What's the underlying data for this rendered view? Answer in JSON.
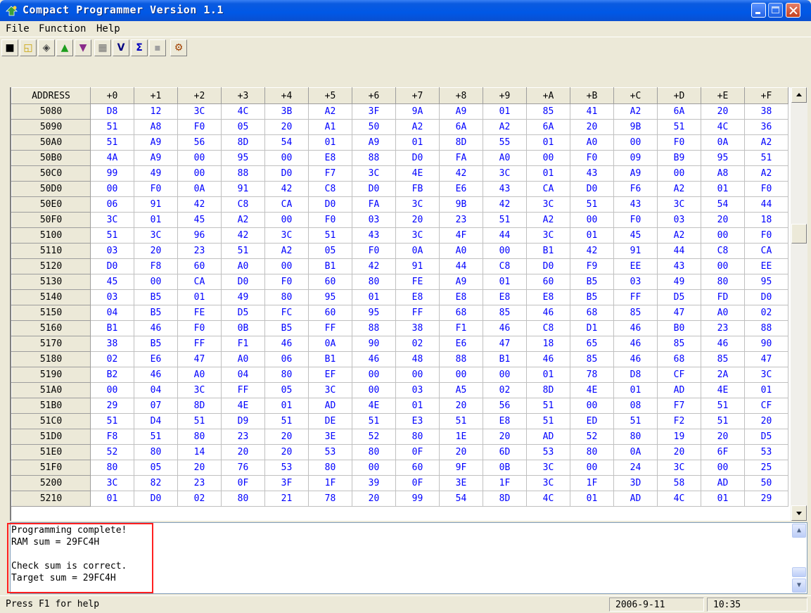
{
  "window": {
    "title": "Compact Programmer Version 1.1"
  },
  "menu": [
    {
      "label": "File",
      "name": "menu-file"
    },
    {
      "label": "Function",
      "name": "menu-function"
    },
    {
      "label": "Help",
      "name": "menu-help"
    }
  ],
  "toolbar": [
    {
      "name": "save-icon",
      "glyph": "■",
      "color": "#000000"
    },
    {
      "name": "open-folder-icon",
      "glyph": "◱",
      "color": "#c8a000"
    },
    {
      "name": "read-chip-icon",
      "glyph": "◈",
      "color": "#404040"
    },
    {
      "name": "upload-arrow-icon",
      "glyph": "▲",
      "color": "#1e9e1e"
    },
    {
      "name": "download-arrow-icon",
      "glyph": "▼",
      "color": "#8a2a8a"
    },
    {
      "name": "erase-icon",
      "glyph": "▦",
      "color": "#707070"
    },
    {
      "name": "verify-icon",
      "glyph": "V",
      "color": "#000080"
    },
    {
      "name": "checksum-icon",
      "glyph": "Σ",
      "color": "#0000c0"
    },
    {
      "name": "lock-icon",
      "glyph": "▪",
      "color": "#a0a0a0"
    },
    {
      "name": "config-icon",
      "glyph": "⚙",
      "color": "#a04000"
    }
  ],
  "grid": {
    "address_header": "ADDRESS",
    "col_headers": [
      "+0",
      "+1",
      "+2",
      "+3",
      "+4",
      "+5",
      "+6",
      "+7",
      "+8",
      "+9",
      "+A",
      "+B",
      "+C",
      "+D",
      "+E",
      "+F"
    ],
    "rows": [
      {
        "addr": "5080",
        "bytes": [
          "D8",
          "12",
          "3C",
          "4C",
          "3B",
          "A2",
          "3F",
          "9A",
          "A9",
          "01",
          "85",
          "41",
          "A2",
          "6A",
          "20",
          "38"
        ]
      },
      {
        "addr": "5090",
        "bytes": [
          "51",
          "A8",
          "F0",
          "05",
          "20",
          "A1",
          "50",
          "A2",
          "6A",
          "A2",
          "6A",
          "20",
          "9B",
          "51",
          "4C",
          "36"
        ]
      },
      {
        "addr": "50A0",
        "bytes": [
          "51",
          "A9",
          "56",
          "8D",
          "54",
          "01",
          "A9",
          "01",
          "8D",
          "55",
          "01",
          "A0",
          "00",
          "F0",
          "0A",
          "A2"
        ]
      },
      {
        "addr": "50B0",
        "bytes": [
          "4A",
          "A9",
          "00",
          "95",
          "00",
          "E8",
          "88",
          "D0",
          "FA",
          "A0",
          "00",
          "F0",
          "09",
          "B9",
          "95",
          "51"
        ]
      },
      {
        "addr": "50C0",
        "bytes": [
          "99",
          "49",
          "00",
          "88",
          "D0",
          "F7",
          "3C",
          "4E",
          "42",
          "3C",
          "01",
          "43",
          "A9",
          "00",
          "A8",
          "A2"
        ]
      },
      {
        "addr": "50D0",
        "bytes": [
          "00",
          "F0",
          "0A",
          "91",
          "42",
          "C8",
          "D0",
          "FB",
          "E6",
          "43",
          "CA",
          "D0",
          "F6",
          "A2",
          "01",
          "F0"
        ]
      },
      {
        "addr": "50E0",
        "bytes": [
          "06",
          "91",
          "42",
          "C8",
          "CA",
          "D0",
          "FA",
          "3C",
          "9B",
          "42",
          "3C",
          "51",
          "43",
          "3C",
          "54",
          "44"
        ]
      },
      {
        "addr": "50F0",
        "bytes": [
          "3C",
          "01",
          "45",
          "A2",
          "00",
          "F0",
          "03",
          "20",
          "23",
          "51",
          "A2",
          "00",
          "F0",
          "03",
          "20",
          "18"
        ]
      },
      {
        "addr": "5100",
        "bytes": [
          "51",
          "3C",
          "96",
          "42",
          "3C",
          "51",
          "43",
          "3C",
          "4F",
          "44",
          "3C",
          "01",
          "45",
          "A2",
          "00",
          "F0"
        ]
      },
      {
        "addr": "5110",
        "bytes": [
          "03",
          "20",
          "23",
          "51",
          "A2",
          "05",
          "F0",
          "0A",
          "A0",
          "00",
          "B1",
          "42",
          "91",
          "44",
          "C8",
          "CA"
        ]
      },
      {
        "addr": "5120",
        "bytes": [
          "D0",
          "F8",
          "60",
          "A0",
          "00",
          "B1",
          "42",
          "91",
          "44",
          "C8",
          "D0",
          "F9",
          "EE",
          "43",
          "00",
          "EE"
        ]
      },
      {
        "addr": "5130",
        "bytes": [
          "45",
          "00",
          "CA",
          "D0",
          "F0",
          "60",
          "80",
          "FE",
          "A9",
          "01",
          "60",
          "B5",
          "03",
          "49",
          "80",
          "95"
        ]
      },
      {
        "addr": "5140",
        "bytes": [
          "03",
          "B5",
          "01",
          "49",
          "80",
          "95",
          "01",
          "E8",
          "E8",
          "E8",
          "E8",
          "B5",
          "FF",
          "D5",
          "FD",
          "D0"
        ]
      },
      {
        "addr": "5150",
        "bytes": [
          "04",
          "B5",
          "FE",
          "D5",
          "FC",
          "60",
          "95",
          "FF",
          "68",
          "85",
          "46",
          "68",
          "85",
          "47",
          "A0",
          "02"
        ]
      },
      {
        "addr": "5160",
        "bytes": [
          "B1",
          "46",
          "F0",
          "0B",
          "B5",
          "FF",
          "88",
          "38",
          "F1",
          "46",
          "C8",
          "D1",
          "46",
          "B0",
          "23",
          "88"
        ]
      },
      {
        "addr": "5170",
        "bytes": [
          "38",
          "B5",
          "FF",
          "F1",
          "46",
          "0A",
          "90",
          "02",
          "E6",
          "47",
          "18",
          "65",
          "46",
          "85",
          "46",
          "90"
        ]
      },
      {
        "addr": "5180",
        "bytes": [
          "02",
          "E6",
          "47",
          "A0",
          "06",
          "B1",
          "46",
          "48",
          "88",
          "B1",
          "46",
          "85",
          "46",
          "68",
          "85",
          "47"
        ]
      },
      {
        "addr": "5190",
        "bytes": [
          "B2",
          "46",
          "A0",
          "04",
          "80",
          "EF",
          "00",
          "00",
          "00",
          "00",
          "01",
          "78",
          "D8",
          "CF",
          "2A",
          "3C"
        ]
      },
      {
        "addr": "51A0",
        "bytes": [
          "00",
          "04",
          "3C",
          "FF",
          "05",
          "3C",
          "00",
          "03",
          "A5",
          "02",
          "8D",
          "4E",
          "01",
          "AD",
          "4E",
          "01"
        ]
      },
      {
        "addr": "51B0",
        "bytes": [
          "29",
          "07",
          "8D",
          "4E",
          "01",
          "AD",
          "4E",
          "01",
          "20",
          "56",
          "51",
          "00",
          "08",
          "F7",
          "51",
          "CF"
        ]
      },
      {
        "addr": "51C0",
        "bytes": [
          "51",
          "D4",
          "51",
          "D9",
          "51",
          "DE",
          "51",
          "E3",
          "51",
          "E8",
          "51",
          "ED",
          "51",
          "F2",
          "51",
          "20"
        ]
      },
      {
        "addr": "51D0",
        "bytes": [
          "F8",
          "51",
          "80",
          "23",
          "20",
          "3E",
          "52",
          "80",
          "1E",
          "20",
          "AD",
          "52",
          "80",
          "19",
          "20",
          "D5"
        ]
      },
      {
        "addr": "51E0",
        "bytes": [
          "52",
          "80",
          "14",
          "20",
          "20",
          "53",
          "80",
          "0F",
          "20",
          "6D",
          "53",
          "80",
          "0A",
          "20",
          "6F",
          "53"
        ]
      },
      {
        "addr": "51F0",
        "bytes": [
          "80",
          "05",
          "20",
          "76",
          "53",
          "80",
          "00",
          "60",
          "9F",
          "0B",
          "3C",
          "00",
          "24",
          "3C",
          "00",
          "25"
        ]
      },
      {
        "addr": "5200",
        "bytes": [
          "3C",
          "82",
          "23",
          "0F",
          "3F",
          "1F",
          "39",
          "0F",
          "3E",
          "1F",
          "3C",
          "1F",
          "3D",
          "58",
          "AD",
          "50"
        ]
      },
      {
        "addr": "5210",
        "bytes": [
          "01",
          "D0",
          "02",
          "80",
          "21",
          "78",
          "20",
          "99",
          "54",
          "8D",
          "4C",
          "01",
          "AD",
          "4C",
          "01",
          "29"
        ]
      }
    ]
  },
  "messages": {
    "lines": [
      "Programming complete!",
      "RAM sum = 29FC4H",
      "",
      "Check sum is correct.",
      "Target sum = 29FC4H"
    ]
  },
  "status": {
    "help": "Press F1 for help",
    "date": "2006-9-11",
    "time": "10:35"
  }
}
